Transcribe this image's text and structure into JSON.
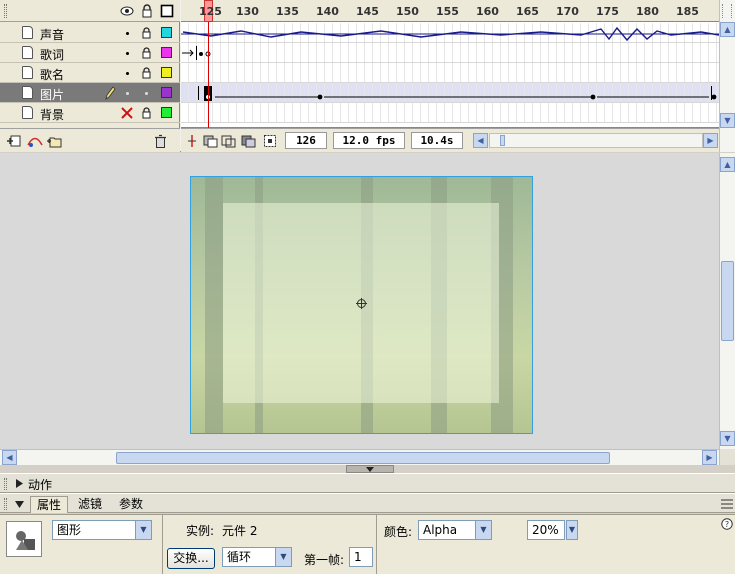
{
  "timeline": {
    "layers": [
      {
        "name": "声音",
        "color": "#22d6e0",
        "selected": false
      },
      {
        "name": "歌词",
        "color": "#ee33ee",
        "selected": false
      },
      {
        "name": "歌名",
        "color": "#f0f020",
        "selected": false
      },
      {
        "name": "图片",
        "color": "#9a33cc",
        "selected": true
      },
      {
        "name": "背景",
        "color": "#22ee33",
        "selected": false
      }
    ],
    "ruler": [
      "125",
      "130",
      "135",
      "140",
      "145",
      "150",
      "155",
      "160",
      "165",
      "170",
      "175",
      "180",
      "185"
    ],
    "current_frame": "126",
    "frame_rate": "12.0 fps",
    "elapsed": "10.4s"
  },
  "panels": {
    "actions_title": "动作",
    "tabs": [
      "属性",
      "滤镜",
      "参数"
    ]
  },
  "properties": {
    "symbol_type": "图形",
    "instance_label": "实例:",
    "instance_name": "元件 2",
    "swap_button": "交换...",
    "loop_option": "循环",
    "first_frame_label": "第一帧:",
    "first_frame": "1",
    "color_label": "颜色:",
    "color_mode": "Alpha",
    "alpha_value": "20%"
  }
}
